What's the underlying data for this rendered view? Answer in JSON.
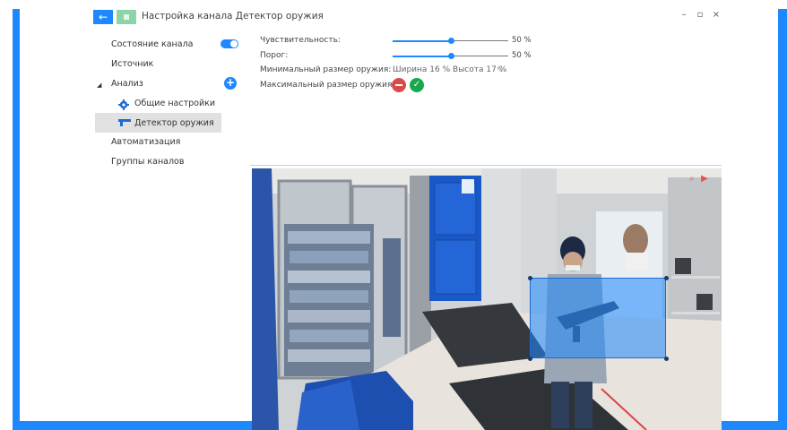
{
  "window": {
    "title": "Настройка канала Детектор оружия",
    "back_icon": "arrow-left-icon",
    "controls": [
      "–",
      "▫",
      "×"
    ]
  },
  "sidebar": {
    "channel_state": "Состояние канала",
    "channel_state_on": true,
    "source": "Источник",
    "analysis": "Анализ",
    "general_settings": "Общие настройки",
    "weapon_detector": "Детектор оружия",
    "automation": "Автоматизация",
    "channel_groups": "Группы каналов"
  },
  "settings": {
    "sensitivity_label": "Чувствительность:",
    "sensitivity_value": "50 %",
    "sensitivity": 0.5,
    "threshold_label": "Порог:",
    "threshold_value": "50 %",
    "threshold": 0.5,
    "min_size_label": "Минимальный размер оружия:",
    "min_size_value": "Ширина 16 % Высота 17 %",
    "max_size_label": "Максимальный размер оружия:"
  },
  "colors": {
    "accent": "#1e88ff",
    "selected_bg": "#e1e1e1",
    "cancel": "#d94a4a",
    "confirm": "#1aa84c"
  }
}
